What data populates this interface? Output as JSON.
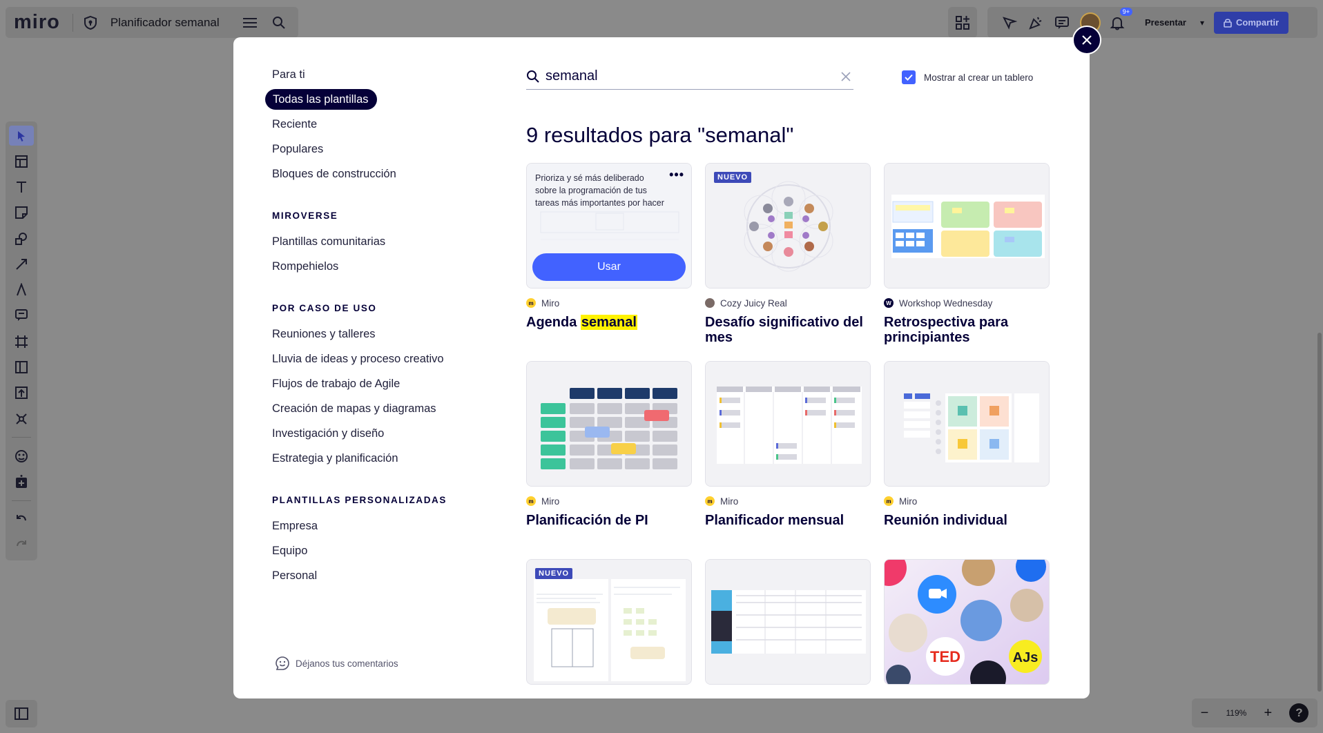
{
  "app": {
    "logo": "miro",
    "board_title": "Planificador semanal",
    "present_label": "Presentar",
    "share_label": "Compartir",
    "notification_count": "9+",
    "zoom_level": "119%",
    "accent_color": "#4262ff"
  },
  "modal": {
    "nav": {
      "top_items": [
        {
          "label": "Para ti"
        },
        {
          "label": "Todas las plantillas",
          "active": true
        },
        {
          "label": "Reciente"
        },
        {
          "label": "Populares"
        },
        {
          "label": "Bloques de construcción"
        }
      ],
      "sections": [
        {
          "heading": "MIROVERSE",
          "items": [
            "Plantillas comunitarias",
            "Rompehielos"
          ]
        },
        {
          "heading": "POR CASO DE USO",
          "items": [
            "Reuniones y talleres",
            "Lluvia de ideas y proceso creativo",
            "Flujos de trabajo de Agile",
            "Creación de mapas y diagramas",
            "Investigación y diseño",
            "Estrategia y planificación"
          ]
        },
        {
          "heading": "PLANTILLAS PERSONALIZADAS",
          "items": [
            "Empresa",
            "Equipo",
            "Personal"
          ]
        }
      ],
      "feedback_label": "Déjanos tus comentarios"
    },
    "search": {
      "value": "semanal"
    },
    "show_on_create": {
      "label": "Mostrar al crear un tablero",
      "checked": true
    },
    "results_heading": "9 resultados para \"semanal\"",
    "cards": [
      {
        "badge": "",
        "hover_description": "Prioriza y sé más deliberado sobre la programación de tus tareas más importantes por hacer",
        "use_label": "Usar",
        "author": "Miro",
        "title_prefix": "Agenda ",
        "title_highlight": "semanal"
      },
      {
        "badge": "NUEVO",
        "author": "Cozy Juicy Real",
        "title": "Desafío significativo del mes"
      },
      {
        "badge": "",
        "author": "Workshop Wednesday",
        "title": "Retrospectiva para principiantes"
      },
      {
        "badge": "",
        "author": "Miro",
        "title": "Planificación de PI"
      },
      {
        "badge": "",
        "author": "Miro",
        "title": "Planificador mensual"
      },
      {
        "badge": "",
        "author": "Miro",
        "title": "Reunión individual"
      },
      {
        "badge": "NUEVO",
        "author": "",
        "title": ""
      },
      {
        "badge": "",
        "author": "",
        "title": ""
      },
      {
        "badge": "",
        "author": "",
        "title": "",
        "thumb_logo_text": "TED"
      }
    ]
  }
}
